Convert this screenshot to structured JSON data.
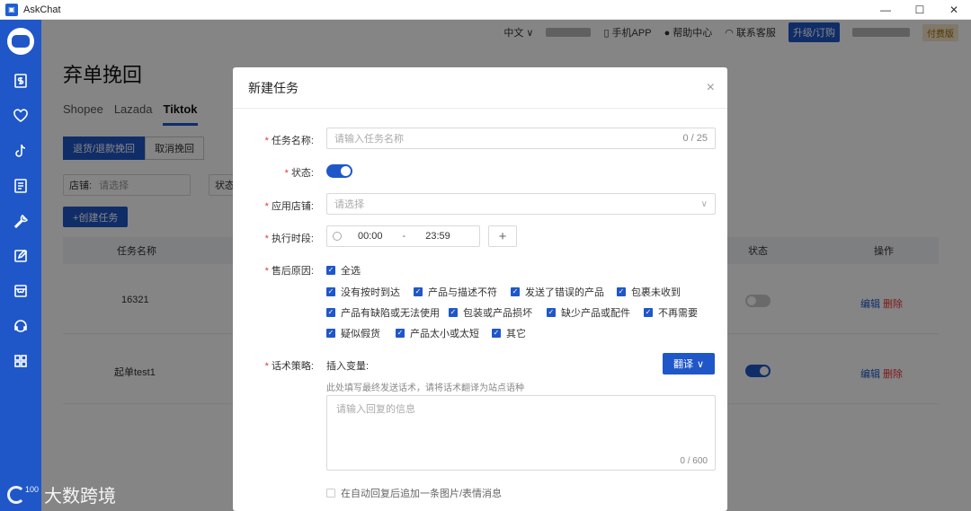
{
  "window": {
    "title": "AskChat",
    "controls": {
      "minimize": "—",
      "maximize": "☐",
      "close": "✕"
    }
  },
  "topnav": {
    "language": "中文 ∨",
    "mobile_app": "手机APP",
    "help_center": "帮助中心",
    "support": "联系客服",
    "upgrade": "升级/订购",
    "paid": "付费版"
  },
  "page": {
    "title": "弃单挽回",
    "platform_tabs": [
      "Shopee",
      "Lazada",
      "Tiktok"
    ],
    "sub_tabs": [
      "退货/退款挽回",
      "取消挽回"
    ],
    "filter_store_label": "店铺:",
    "filter_store_placeholder": "请选择",
    "filter_status_label": "状态",
    "create_button": "+创建任务",
    "table": {
      "col_name": "任务名称",
      "col_status": "状态",
      "col_action": "操作",
      "rows": [
        {
          "name": "16321",
          "edit": "编辑",
          "delete": "删除"
        },
        {
          "name": "起单test1",
          "edit": "编辑",
          "delete": "删除"
        }
      ]
    }
  },
  "modal": {
    "title": "新建任务",
    "close": "×",
    "task_name_label": "任务名称:",
    "task_name_placeholder": "请输入任务名称",
    "task_name_count": "0 / 25",
    "status_label": "状态:",
    "store_label": "应用店铺:",
    "store_placeholder": "请选择",
    "time_label": "执行时段:",
    "time_start": "00:00",
    "time_sep": "-",
    "time_end": "23:59",
    "add_time": "+",
    "reason_label": "售后原因:",
    "reasons": {
      "all": "全选",
      "r1": "没有按时到达",
      "r2": "产品与描述不符",
      "r3": "发送了错误的产品",
      "r4": "包裹未收到",
      "r5": "产品有缺陷或无法使用",
      "r6": "包装或产品损坏",
      "r7": "缺少产品或配件",
      "r8": "不再需要",
      "r9": "疑似假货",
      "r10": "产品太小或太短",
      "r11": "其它"
    },
    "strategy_label": "话术策略:",
    "insert_variable": "插入变量:",
    "translate_button": "翻译",
    "strategy_hint": "此处填写最终发送话术，请将话术翻译为站点语种",
    "reply_placeholder": "请输入回复的信息",
    "reply_count": "0 / 600",
    "append_image": "在自动回复后追加一条图片/表情消息"
  },
  "watermark": {
    "text": "大数跨境",
    "sup": "100"
  }
}
